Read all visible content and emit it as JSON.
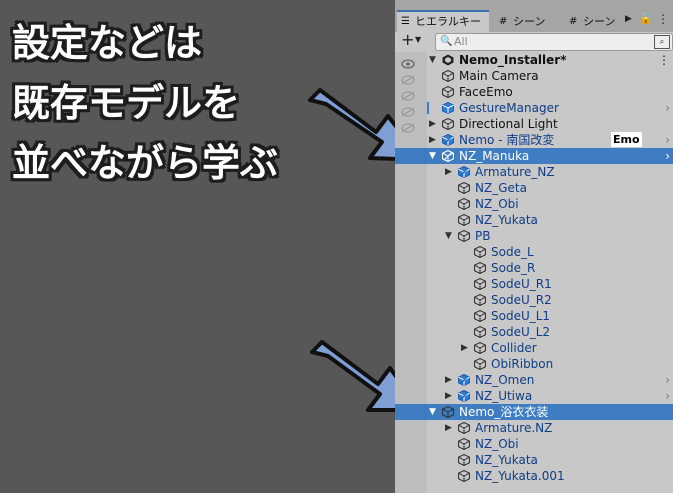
{
  "caption": {
    "line1": "設定などは",
    "line2": "既存モデルを",
    "line3": "並べながら学ぶ"
  },
  "tabs": {
    "hierarchy": "ヒエラルキー",
    "scene1": "シーン",
    "scene2": "シーン"
  },
  "toolbar": {
    "add": "+",
    "search_placeholder": "All"
  },
  "badge": "Emo",
  "hierarchy": {
    "root": "Nemo_Installer*",
    "rows": [
      {
        "label": "Main Camera"
      },
      {
        "label": "FaceEmo"
      },
      {
        "label": "GestureManager"
      },
      {
        "label": "Directional Light"
      },
      {
        "label": "Nemo - 南国改変"
      },
      {
        "label": "NZ_Manuka"
      },
      {
        "label": "Armature_NZ"
      },
      {
        "label": "NZ_Geta"
      },
      {
        "label": "NZ_Obi"
      },
      {
        "label": "NZ_Yukata"
      },
      {
        "label": "PB"
      },
      {
        "label": "Sode_L"
      },
      {
        "label": "Sode_R"
      },
      {
        "label": "SodeU_R1"
      },
      {
        "label": "SodeU_R2"
      },
      {
        "label": "SodeU_L1"
      },
      {
        "label": "SodeU_L2"
      },
      {
        "label": "Collider"
      },
      {
        "label": "ObiRibbon"
      },
      {
        "label": "NZ_Omen"
      },
      {
        "label": "NZ_Utiwa"
      },
      {
        "label": "Nemo_浴衣衣装"
      },
      {
        "label": "Armature.NZ"
      },
      {
        "label": "NZ_Obi"
      },
      {
        "label": "NZ_Yukata"
      },
      {
        "label": "NZ_Yukata.001"
      }
    ]
  }
}
